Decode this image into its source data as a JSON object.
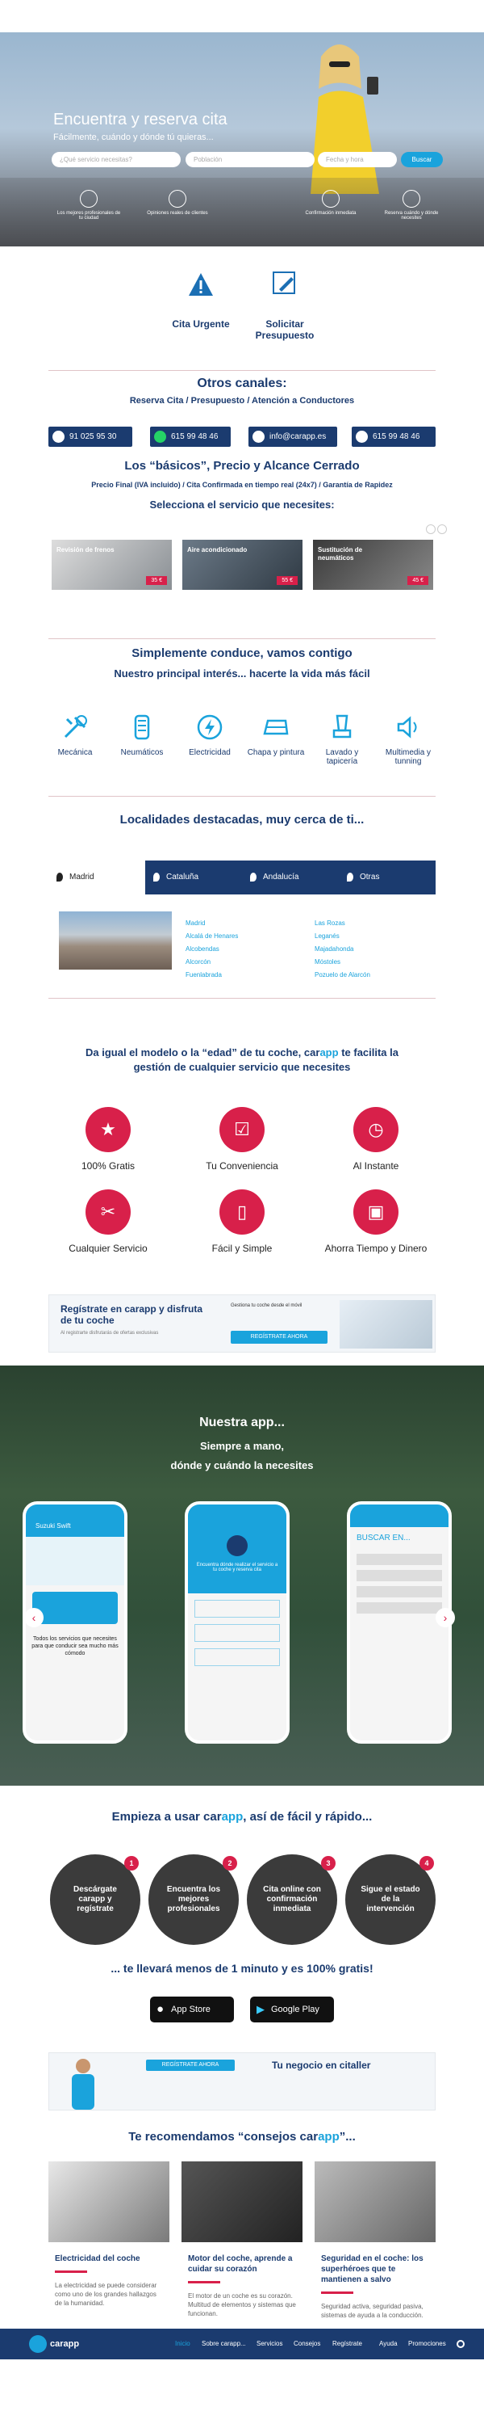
{
  "hero": {
    "title": "Encuentra y reserva cita",
    "subtitle": "Fácilmente, cuándo y dónde tú quieras...",
    "service_placeholder": "¿Qué servicio necesitas?",
    "location_placeholder": "Población",
    "date_placeholder": "Fecha y hora",
    "search_label": "Buscar",
    "features": [
      "Los mejores profesionales de tu ciudad",
      "Opiniones reales de clientes",
      "Confirmación inmediata",
      "Reserva cuándo y dónde necesites"
    ]
  },
  "quick": {
    "cita": "Cita Urgente",
    "presupuesto": "Solicitar Presupuesto"
  },
  "channels": {
    "title": "Otros canales:",
    "subtitle": "Reserva Cita / Presupuesto / Atención a Conductores",
    "phone": "91 025 95 30",
    "whatsapp": "615 99 48 46",
    "email": "info@carapp.es",
    "mobile": "615 99 48 46"
  },
  "basics": {
    "title": "Los “básicos”, Precio y Alcance Cerrado",
    "subtitle": "Precio Final (IVA incluido) / Cita Confirmada en tiempo real (24x7) / Garantía de Rapidez",
    "select": "Selecciona el servicio que necesites:",
    "cards": [
      {
        "title": "Revisión de frenos",
        "price": "35 €"
      },
      {
        "title": "Aire acondicionado",
        "price": "55 €"
      },
      {
        "title": "Sustitución de neumáticos",
        "price": "45 €"
      }
    ]
  },
  "drive": {
    "title": "Simplemente conduce, vamos contigo",
    "subtitle": "Nuestro principal interés... hacerte la vida más fácil",
    "categories": [
      "Mecánica",
      "Neumáticos",
      "Electricidad",
      "Chapa y pintura",
      "Lavado y tapicería",
      "Multimedia y tunning"
    ]
  },
  "locations": {
    "title": "Localidades destacadas, muy cerca de ti...",
    "tabs": [
      "Madrid",
      "Cataluña",
      "Andalucía",
      "Otras"
    ],
    "col1": [
      "Madrid",
      "Alcalá de Henares",
      "Alcobendas",
      "Alcorcón",
      "Fuenlabrada"
    ],
    "col2": [
      "Las Rozas",
      "Leganés",
      "Majadahonda",
      "Móstoles",
      "Pozuelo de Alarcón"
    ]
  },
  "benefits": {
    "title_a": "Da igual el modelo o la “edad” de tu coche,",
    "brand_a": "car",
    "brand_b": "app",
    "title_b": "te facilita la",
    "title_c": "gestión de cualquier servicio que necesites",
    "items": [
      "100% Gratis",
      "Tu Conveniencia",
      "Al Instante",
      "Cualquier Servicio",
      "Fácil y Simple",
      "Ahorra Tiempo y Dinero"
    ]
  },
  "banner": {
    "title": "Regístrate en carapp y disfruta de tu coche",
    "text": "Al registrarte disfrutarás de ofertas exclusivas",
    "promo": "Gestiona tu coche desde el móvil",
    "cta": "REGÍSTRATE AHORA"
  },
  "app": {
    "title": "Nuestra app...",
    "line1": "Siempre a mano,",
    "line2": "dónde y cuándo la necesites",
    "phone1_title": "Suzuki Swift",
    "phone1_text": "Todos los servicios que necesites para que conducir sea mucho más cómodo",
    "phone2_text": "Encuentra dónde realizar el servicio a tu coche y reserva cita",
    "phone3_title": "BUSCAR EN..."
  },
  "steps": {
    "title_a": "Empieza a usar",
    "title_b": "así de fácil y rápido...",
    "items": [
      "Descárgate carapp y regístrate",
      "Encuentra los mejores profesionales",
      "Cita online con confirmación inmediata",
      "Sigue el estado de la intervención"
    ],
    "numbers": [
      "1",
      "2",
      "3",
      "4"
    ],
    "footer": "... te llevará menos de 1 minuto y es 100% gratis!",
    "appstore": "App Store",
    "googleplay": "Google Play"
  },
  "business": {
    "cta": "REGÍSTRATE AHORA",
    "title": "Tu negocio en citaller"
  },
  "tips": {
    "title_a": "Te recomendamos “consejos",
    "title_b": "”...",
    "cards": [
      {
        "title": "Electricidad del coche",
        "text": "La electricidad se puede considerar como uno de los grandes hallazgos de la humanidad."
      },
      {
        "title": "Motor del coche, aprende a cuidar su corazón",
        "text": "El motor de un coche es su corazón. Multitud de elementos y sistemas que funcionan."
      },
      {
        "title": "Seguridad en el coche: los superhéroes que te mantienen a salvo",
        "text": "Seguridad activa, seguridad pasiva, sistemas de ayuda a la conducción."
      }
    ]
  },
  "nav": {
    "logo": "carapp",
    "items": [
      "Inicio",
      "Sobre carapp...",
      "Servicios",
      "Consejos",
      "Regístrate",
      "Ayuda",
      "Promociones"
    ]
  }
}
